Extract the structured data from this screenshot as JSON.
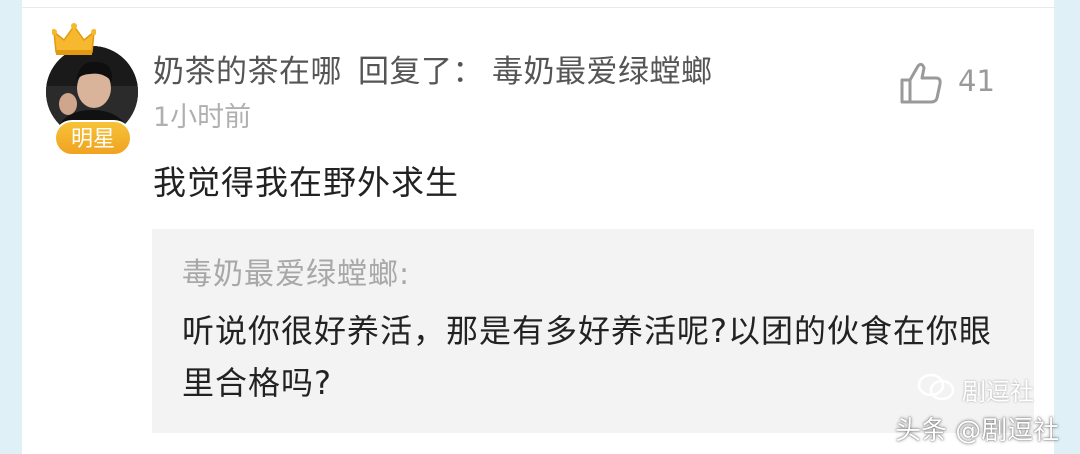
{
  "comment": {
    "user_name": "奶茶的茶在哪",
    "reply_verb": "回复了：",
    "reply_target": "毒奶最爱绿螳螂",
    "timestamp": "1小时前",
    "badge": "明星",
    "body": "我觉得我在野外求生",
    "likes": "41"
  },
  "quote": {
    "author": "毒奶最爱绿螳螂:",
    "text": "听说你很好养活，那是有多好养活呢?以团的伙食在你眼里合格吗?"
  },
  "watermark": {
    "icon_label": "剧逗社",
    "text": "头条 @剧逗社"
  },
  "icons": {
    "crown": "crown-icon",
    "like": "thumbs-up-icon",
    "watermark": "wechat-icon"
  },
  "colors": {
    "frame": "#dff1f7",
    "badge": "#f0a321",
    "quote_bg": "#f3f3f3"
  }
}
